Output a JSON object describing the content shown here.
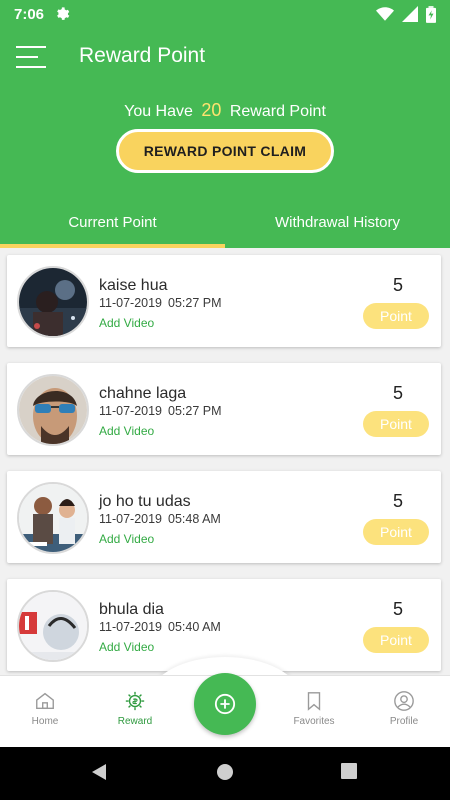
{
  "status": {
    "time": "7:06"
  },
  "header": {
    "title": "Reward Point",
    "reward_prefix": "You Have",
    "reward_count": "20",
    "reward_suffix": "Reward Point",
    "claim_label": "REWARD POINT CLAIM"
  },
  "tabs": [
    {
      "label": "Current Point"
    },
    {
      "label": "Withdrawal History"
    }
  ],
  "items": [
    {
      "title": "kaise hua",
      "date": "11-07-2019",
      "time": "05:27 PM",
      "action": "Add Video",
      "points": "5",
      "point_label": "Point"
    },
    {
      "title": "chahne laga",
      "date": "11-07-2019",
      "time": "05:27 PM",
      "action": "Add Video",
      "points": "5",
      "point_label": "Point"
    },
    {
      "title": "jo ho tu udas",
      "date": "11-07-2019",
      "time": "05:48 AM",
      "action": "Add Video",
      "points": "5",
      "point_label": "Point"
    },
    {
      "title": "bhula dia",
      "date": "11-07-2019",
      "time": "05:40 AM",
      "action": "Add Video",
      "points": "5",
      "point_label": "Point"
    }
  ],
  "nav": [
    {
      "label": "Home",
      "icon": "home-icon"
    },
    {
      "label": "Reward",
      "icon": "reward-icon"
    },
    {
      "label": "Favorites",
      "icon": "bookmark-icon"
    },
    {
      "label": "Profile",
      "icon": "profile-icon"
    }
  ],
  "colors": {
    "brand_green": "#45b954",
    "accent_yellow": "#f9d35e",
    "point_button": "#fce27d",
    "active_nav": "#2f9a3f"
  }
}
